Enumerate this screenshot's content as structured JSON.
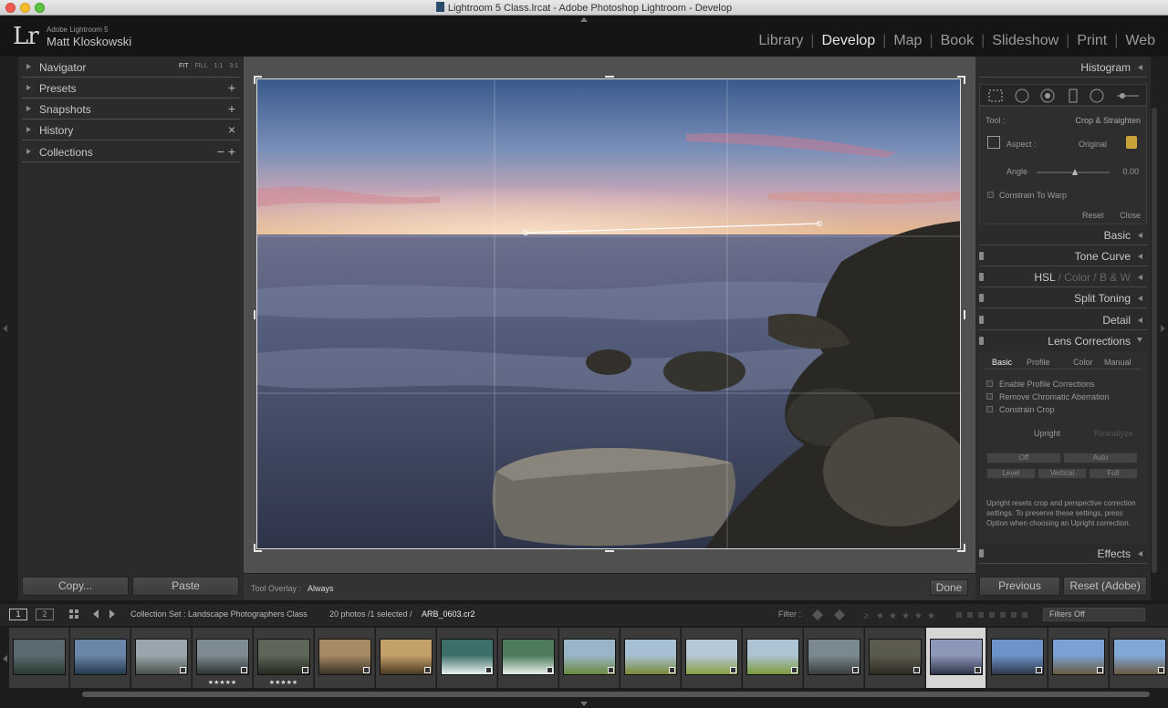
{
  "window": {
    "title": "Lightroom 5 Class.lrcat - Adobe Photoshop Lightroom - Develop"
  },
  "identity": {
    "logo": "Lr",
    "app_name": "Adobe Lightroom 5",
    "user": "Matt Kloskowski"
  },
  "modules": [
    "Library",
    "Develop",
    "Map",
    "Book",
    "Slideshow",
    "Print",
    "Web"
  ],
  "active_module": "Develop",
  "left_panel": {
    "navigator": {
      "label": "Navigator",
      "options": [
        "FIT",
        "FILL",
        "1:1",
        "3:1"
      ]
    },
    "presets": {
      "label": "Presets",
      "action": "+"
    },
    "snapshots": {
      "label": "Snapshots",
      "action": "+"
    },
    "history": {
      "label": "History",
      "action": "×"
    },
    "collections": {
      "label": "Collections",
      "action": "− +"
    },
    "copy_label": "Copy...",
    "paste_label": "Paste"
  },
  "toolbar": {
    "overlay_label": "Tool Overlay :",
    "overlay_value": "Always",
    "done_label": "Done"
  },
  "right_panel": {
    "histogram": "Histogram",
    "crop": {
      "tool_label": "Tool :",
      "tool_value": "Crop & Straighten",
      "aspect_label": "Aspect :",
      "aspect_value": "Original",
      "angle_label": "Angle",
      "angle_value": "0.00",
      "constrain_warp": "Constrain To Warp",
      "reset": "Reset",
      "close": "Close"
    },
    "sections": {
      "basic": "Basic",
      "tone_curve": "Tone Curve",
      "hsl": "HSL",
      "color": "Color",
      "bw": "B & W",
      "split_toning": "Split Toning",
      "detail": "Detail",
      "lens_corrections": "Lens Corrections",
      "effects": "Effects"
    },
    "lens": {
      "tabs": [
        "Basic",
        "Profile",
        "Color",
        "Manual"
      ],
      "enable_profile": "Enable Profile Corrections",
      "remove_ca": "Remove Chromatic Aberration",
      "constrain_crop": "Constrain Crop",
      "upright": "Upright",
      "reanalyze": "Reanalyze",
      "upright_buttons": [
        "Off",
        "Auto",
        "Level",
        "Vertical",
        "Full"
      ],
      "note": "Upright resets crop and perspective correction settings. To preserve these settings, press Option when choosing an Upright correction."
    },
    "previous_label": "Previous",
    "reset_label": "Reset (Adobe)"
  },
  "filmstrip": {
    "page1": "1",
    "page2": "2",
    "source": "Collection Set : Landscape Photographers Class",
    "count": "20 photos /1 selected /",
    "selected_file": "ARB_0603.cr2",
    "filter_label": "Filter :",
    "filter_value": "Filters Off",
    "stars": "★★★★★"
  }
}
